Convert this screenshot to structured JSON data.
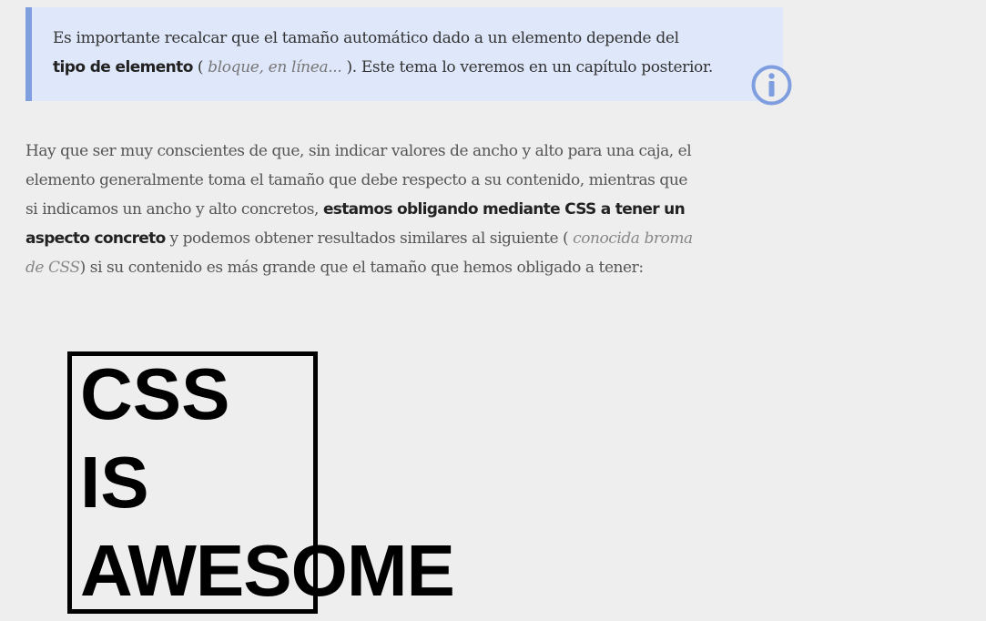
{
  "callout": {
    "line1": "Es importante recalcar que el tamaño automático dado a un elemento depende del",
    "bold": "tipo de elemento",
    "open_paren": " ( ",
    "italic": "bloque, en línea...",
    "rest": " ). Este tema lo veremos en un capítulo posterior.",
    "icon": "info-icon",
    "accent_color": "#7f9ee0",
    "background_color": "#dfe8fb"
  },
  "paragraph": {
    "line1": "Hay que ser muy conscientes de que, sin indicar valores de ancho y alto para una caja, el",
    "line2": "elemento generalmente toma el tamaño que debe respecto a su contenido, mientras que",
    "line3_pre": "si indicamos un ancho y alto concretos, ",
    "line3_bold": "estamos obligando mediante CSS a tener un",
    "line4_bold": "aspecto concreto",
    "line4_mid": " y podemos obtener resultados similares al siguiente ( ",
    "line4_italic": "conocida broma",
    "line5_italic": "de CSS",
    "line5_rest": ") si su contenido es más grande que el tamaño que hemos obligado a tener:"
  },
  "demo": {
    "word1": "CSS",
    "word2": "IS",
    "word3": "AWESOME"
  }
}
